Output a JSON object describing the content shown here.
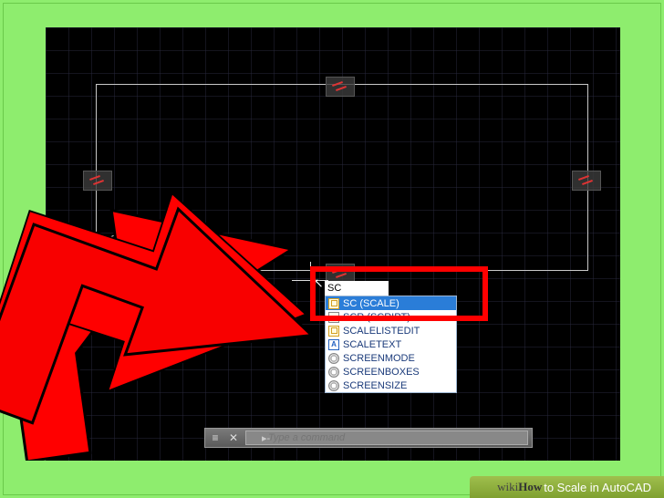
{
  "input": {
    "value": "SC"
  },
  "autocomplete": {
    "items": [
      {
        "label": "SC (SCALE)",
        "selected": true,
        "icon": "scale"
      },
      {
        "label": "SCR (SCRIPT)",
        "selected": false,
        "icon": "script"
      },
      {
        "label": "SCALELISTEDIT",
        "selected": false,
        "icon": "scale"
      },
      {
        "label": "SCALETEXT",
        "selected": false,
        "icon": "text"
      },
      {
        "label": "SCREENMODE",
        "selected": false,
        "icon": "gear"
      },
      {
        "label": "SCREENBOXES",
        "selected": false,
        "icon": "gear"
      },
      {
        "label": "SCREENSIZE",
        "selected": false,
        "icon": "gear"
      }
    ]
  },
  "commandbar": {
    "placeholder": "Type a command",
    "prefix": "▸-"
  },
  "caption": {
    "brand_pre": "wiki",
    "brand_bold": "How",
    "title": " to Scale in AutoCAD"
  }
}
